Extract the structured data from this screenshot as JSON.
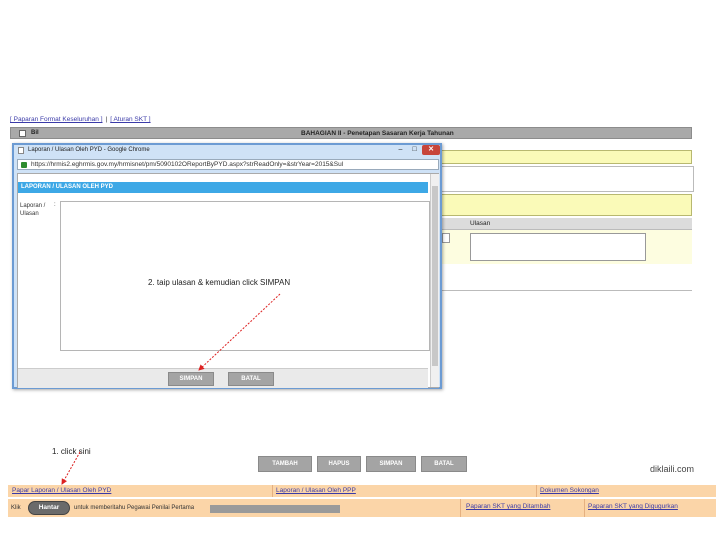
{
  "top_links": {
    "paparan_format": "[ Paparan Format Keseluruhan ]",
    "aturan_skt": "[ Aturan SKT ]"
  },
  "table": {
    "bil": "Bil",
    "bahagian_title": "BAHAGIAN II - Penetapan Sasaran Kerja Tahunan",
    "ulasan_header": "Ulasan"
  },
  "popup": {
    "title": "Laporan / Ulasan Oleh PYD - Google Chrome",
    "url": "https://hrmis2.eghrmis.gov.my/hrmisnet/pm/5090102OReportByPYD.aspx?strReadOnly=&strYear=2015&Sul",
    "header": "LAPORAN / ULASAN OLEH PYD",
    "field_label_line1": "Laporan /",
    "field_label_line2": "Ulasan",
    "colon": ":",
    "annotation": "2. taip ulasan & kemudian click SIMPAN",
    "simpan": "SIMPAN",
    "batal": "BATAL",
    "min_glyph": "–",
    "max_glyph": "□",
    "close_glyph": "✕"
  },
  "toolbar": {
    "tambah": "TAMBAH",
    "hapus": "HAPUS",
    "simpan": "SIMPAN",
    "batal": "BATAL"
  },
  "annotation_1": "1. click sini",
  "brand": "diklaili.com",
  "links": {
    "papar_laporan": "Papar Laporan / Ulasan Oleh PYD",
    "laporan_ppp": "Laporan / Ulasan Oleh PPP",
    "dokumen_sokongan": "Dokumen Sokongan",
    "paparan_skt_ditambah": "Paparan SKT yang Ditambah",
    "paparan_skt_digugurkan": "Paparan SKT yang Digugurkan"
  },
  "submit": {
    "klik": "Klik",
    "hantar": "Hantar",
    "message": "untuk memberitahu Pegawai Penilai Pertama"
  }
}
